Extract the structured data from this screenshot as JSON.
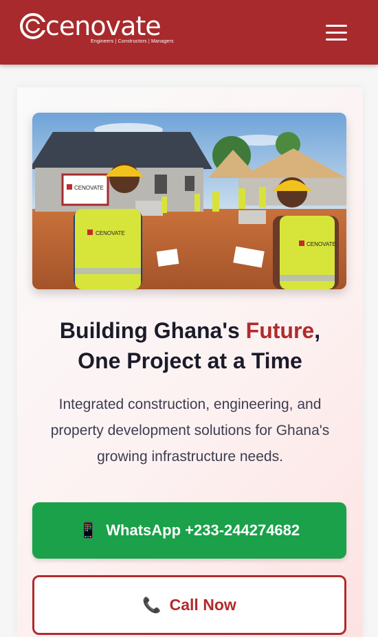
{
  "brand": {
    "name": "cenovate",
    "tagline": "Engineers | Constructors | Managers",
    "primary_color": "#a82a2c",
    "accent_color": "#b22a2c",
    "whatsapp_color": "#1aa149"
  },
  "header": {
    "menu_icon": "hamburger-menu-icon"
  },
  "hero": {
    "image_signs": {
      "sign_label": "CENOVATE",
      "vest_label": "CENOVATE"
    },
    "title_part1": "Building Ghana's ",
    "title_accent": "Future",
    "title_part2": ",",
    "title_line2": "One Project at a Time",
    "subtitle": "Integrated construction, engineering, and property development solutions for Ghana's growing infrastructure needs."
  },
  "actions": {
    "whatsapp_icon": "📱",
    "whatsapp_label": "WhatsApp +233-244274682",
    "call_icon": "📞",
    "call_label": "Call Now"
  }
}
